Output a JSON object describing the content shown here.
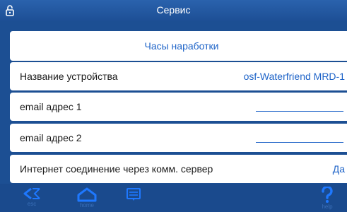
{
  "window": {
    "title": "Сервис"
  },
  "header_button": {
    "label": "Часы наработки"
  },
  "rows": [
    {
      "label": "Название устройства",
      "value": "osf-Waterfriend MRD-1"
    },
    {
      "label": "email адрес 1",
      "value": ""
    },
    {
      "label": "email адрес 2",
      "value": ""
    },
    {
      "label": "Интернет соединение через комм. сервер",
      "value": "Да"
    }
  ],
  "toolbar": {
    "esc_label": "esc",
    "home_label": "home",
    "help_label": "help"
  },
  "icons": {
    "lock": "unlock-icon",
    "esc": "back-arrow-icon",
    "home": "home-icon",
    "menu": "menu-icon",
    "help": "question-mark-icon"
  },
  "colors": {
    "background": "#1c4f93",
    "accent_text": "#1f64c8",
    "panel": "#ffffff"
  }
}
